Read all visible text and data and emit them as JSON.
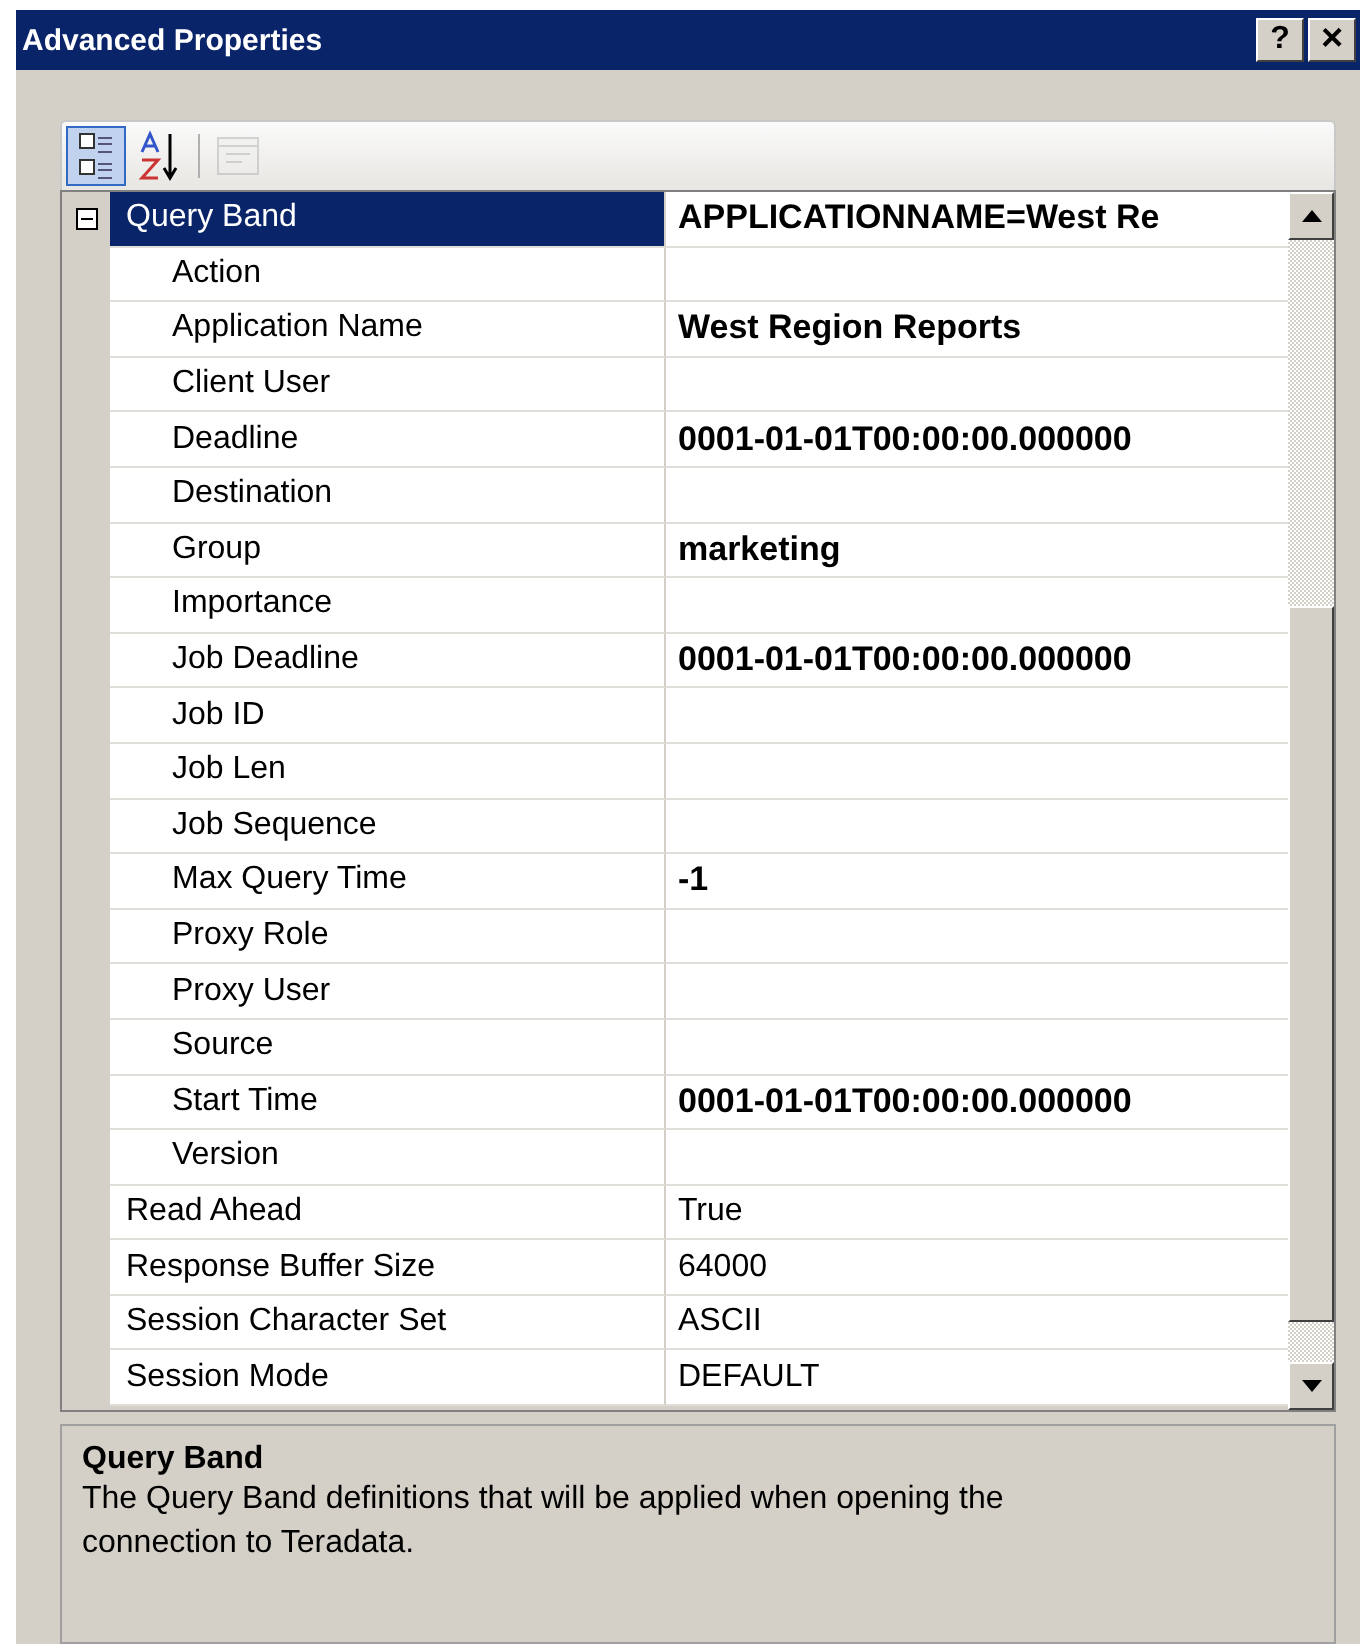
{
  "window": {
    "title": "Advanced Properties",
    "buttons": [
      {
        "kind": "help",
        "label": "?"
      },
      {
        "kind": "close",
        "label": "×"
      }
    ]
  },
  "toolbar": {
    "buttons": [
      {
        "kind": "categorized",
        "selected": true,
        "disabled": false
      },
      {
        "kind": "alphabetical",
        "selected": false,
        "disabled": false
      },
      {
        "kind": "property-pages",
        "selected": false,
        "disabled": true
      }
    ]
  },
  "properties": [
    {
      "name": "Query Band",
      "value": "APPLICATIONNAME=West Re",
      "modified": true,
      "selected": true,
      "expanded": true,
      "children": [
        {
          "name": "Action",
          "selected": false
        },
        {
          "name": "Application Name",
          "value": "West Region Reports",
          "modified": true,
          "selected": false
        },
        {
          "name": "Client User",
          "selected": false
        },
        {
          "name": "Deadline",
          "value": "0001-01-01T00:00:00.000000",
          "modified": true,
          "selected": false
        },
        {
          "name": "Destination",
          "selected": false
        },
        {
          "name": "Group",
          "value": "marketing",
          "modified": true,
          "selected": false
        },
        {
          "name": "Importance",
          "selected": false
        },
        {
          "name": "Job Deadline",
          "value": "0001-01-01T00:00:00.000000",
          "modified": true,
          "selected": false
        },
        {
          "name": "Job ID",
          "selected": false
        },
        {
          "name": "Job Len",
          "selected": false
        },
        {
          "name": "Job Sequence",
          "selected": false
        },
        {
          "name": "Max Query Time",
          "value": "-1",
          "modified": true,
          "selected": false
        },
        {
          "name": "Proxy Role",
          "selected": false
        },
        {
          "name": "Proxy User",
          "selected": false
        },
        {
          "name": "Source",
          "selected": false
        },
        {
          "name": "Start Time",
          "value": "0001-01-01T00:00:00.000000",
          "modified": true,
          "selected": false
        },
        {
          "name": "Version",
          "selected": false
        }
      ]
    },
    {
      "name": "Read Ahead",
      "value": "True",
      "modified": false,
      "selected": false
    },
    {
      "name": "Response Buffer Size",
      "value": "64000",
      "modified": false,
      "selected": false
    },
    {
      "name": "Session Character Set",
      "value": "ASCII",
      "modified": false,
      "selected": false
    },
    {
      "name": "Session Mode",
      "value": "DEFAULT",
      "modified": false,
      "selected": false
    }
  ],
  "description": {
    "title": "Query Band",
    "text": "The Query Band definitions that will be applied when opening the connection to Teradata."
  }
}
